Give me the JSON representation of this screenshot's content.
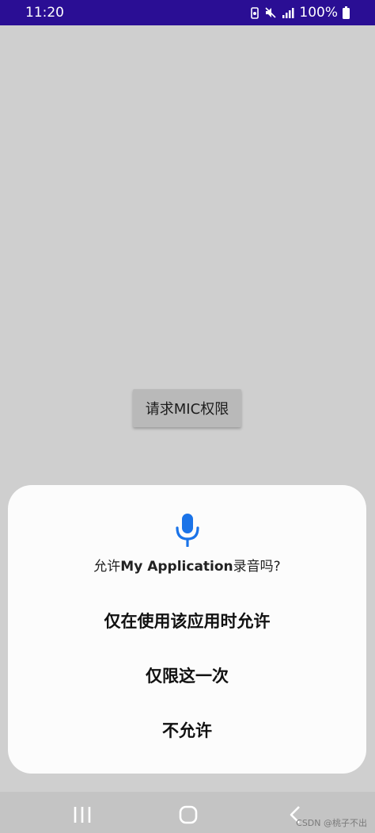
{
  "status_bar": {
    "time": "11:20",
    "battery": "100%",
    "icons": [
      "recording-icon",
      "mute-icon",
      "signal-icon",
      "battery-icon"
    ]
  },
  "main": {
    "request_button_label": "请求MIC权限"
  },
  "dialog": {
    "icon": "microphone-icon",
    "prompt_prefix": "允许",
    "app_name": "My Application",
    "prompt_suffix": "录音吗?",
    "options": [
      "仅在使用该应用时允许",
      "仅限这一次",
      "不允许"
    ]
  },
  "nav_bar": {
    "icons": [
      "recent-apps-icon",
      "home-icon",
      "back-icon"
    ]
  },
  "watermark": "CSDN @桃子不出",
  "colors": {
    "status_bar": "#2a0e94",
    "accent": "#1a73e8",
    "background": "#cfcfcf"
  }
}
